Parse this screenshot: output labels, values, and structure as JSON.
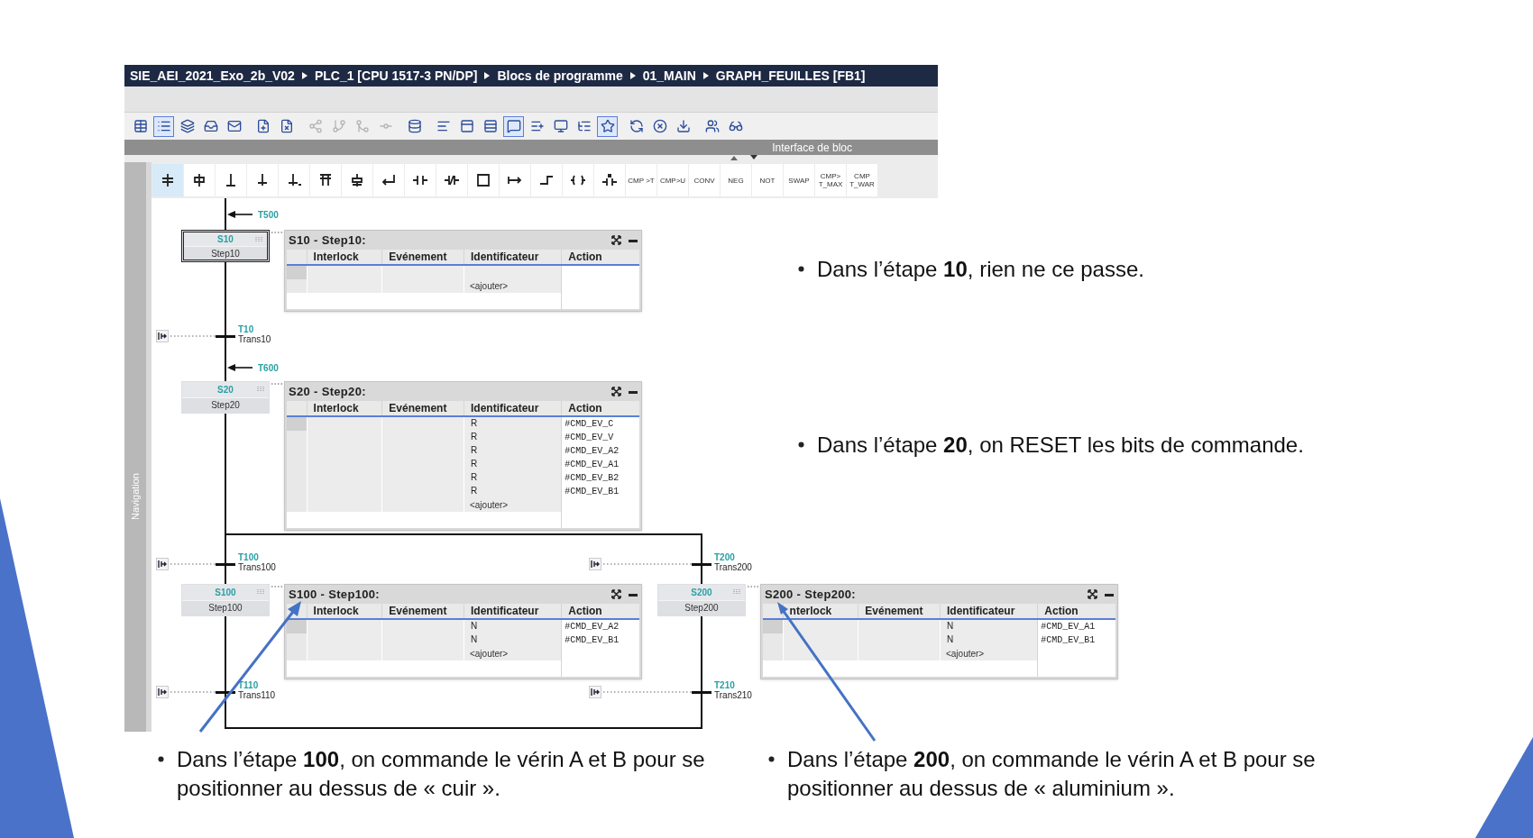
{
  "breadcrumb": [
    "SIE_AEI_2021_Exo_2b_V02",
    "PLC_1 [CPU 1517-3 PN/DP]",
    "Blocs de programme",
    "01_MAIN",
    "GRAPH_FEUILLES [FB1]"
  ],
  "toolbar": [
    {
      "selected": false,
      "disabled": false
    },
    {
      "selected": true,
      "disabled": false
    },
    {
      "selected": false,
      "disabled": false
    },
    {
      "selected": false,
      "disabled": false
    },
    {
      "selected": false,
      "disabled": false
    },
    {
      "selected": false,
      "disabled": false
    },
    {
      "selected": false,
      "disabled": false
    },
    {
      "selected": false,
      "disabled": true
    },
    {
      "selected": false,
      "disabled": true
    },
    {
      "selected": false,
      "disabled": true
    },
    {
      "selected": false,
      "disabled": true
    },
    {
      "selected": false,
      "disabled": false
    },
    {
      "selected": false,
      "disabled": false
    },
    {
      "selected": false,
      "disabled": false
    },
    {
      "selected": false,
      "disabled": false
    },
    {
      "selected": true,
      "disabled": false
    },
    {
      "selected": false,
      "disabled": false
    },
    {
      "selected": false,
      "disabled": false
    },
    {
      "selected": false,
      "disabled": false
    },
    {
      "selected": true,
      "disabled": false
    },
    {
      "selected": false,
      "disabled": false
    },
    {
      "selected": false,
      "disabled": false
    },
    {
      "selected": false,
      "disabled": false
    },
    {
      "selected": false,
      "disabled": false
    },
    {
      "selected": false,
      "disabled": false
    }
  ],
  "interface_label": "Interface de bloc",
  "palette": [
    {
      "kind": "icon",
      "selected": true
    },
    {
      "kind": "icon",
      "selected": false
    },
    {
      "kind": "icon",
      "selected": false
    },
    {
      "kind": "icon",
      "selected": false
    },
    {
      "kind": "icon",
      "selected": false
    },
    {
      "kind": "icon",
      "selected": false
    },
    {
      "kind": "icon",
      "selected": false
    },
    {
      "kind": "icon",
      "selected": false
    },
    {
      "kind": "icon",
      "selected": false
    },
    {
      "kind": "icon",
      "selected": false
    },
    {
      "kind": "icon",
      "selected": false
    },
    {
      "kind": "icon",
      "selected": false
    },
    {
      "kind": "icon",
      "selected": false
    },
    {
      "kind": "icon",
      "selected": false
    },
    {
      "kind": "icon",
      "selected": false
    },
    {
      "kind": "text",
      "selected": false,
      "lines": [
        "CMP >T"
      ]
    },
    {
      "kind": "text",
      "selected": false,
      "lines": [
        "CMP>U"
      ]
    },
    {
      "kind": "text",
      "selected": false,
      "lines": [
        "CONV"
      ]
    },
    {
      "kind": "text",
      "selected": false,
      "lines": [
        "NEG"
      ]
    },
    {
      "kind": "text",
      "selected": false,
      "lines": [
        "NOT"
      ]
    },
    {
      "kind": "text",
      "selected": false,
      "lines": [
        "SWAP"
      ]
    },
    {
      "kind": "text",
      "selected": false,
      "lines": [
        "CMP>",
        "T_MAX"
      ]
    },
    {
      "kind": "text",
      "selected": false,
      "lines": [
        "CMP",
        "T_WAR"
      ]
    }
  ],
  "navigation_label": "Navigation",
  "graph": {
    "jumps": [
      {
        "label": "T500"
      },
      {
        "label": "T600"
      }
    ],
    "steps": [
      {
        "number": "S10",
        "name": "Step10",
        "selected": true,
        "table": {
          "title": "S10 - Step10:",
          "columns": [
            "Interlock",
            "Evénement",
            "Identificateur",
            "Action"
          ],
          "add_label": "<ajouter>"
        }
      },
      {
        "number": "S20",
        "name": "Step20",
        "selected": false,
        "table": {
          "title": "S20 - Step20:",
          "columns": [
            "Interlock",
            "Evénement",
            "Identificateur",
            "Action"
          ],
          "rows": [
            {
              "identifier": "R",
              "action": "#CMD_EV_C"
            },
            {
              "identifier": "R",
              "action": "#CMD_EV_V"
            },
            {
              "identifier": "R",
              "action": "#CMD_EV_A2"
            },
            {
              "identifier": "R",
              "action": "#CMD_EV_A1"
            },
            {
              "identifier": "R",
              "action": "#CMD_EV_B2"
            },
            {
              "identifier": "R",
              "action": "#CMD_EV_B1"
            }
          ],
          "add_label": "<ajouter>"
        }
      },
      {
        "number": "S100",
        "name": "Step100",
        "selected": false,
        "table": {
          "title": "S100 - Step100:",
          "columns": [
            "Interlock",
            "Evénement",
            "Identificateur",
            "Action"
          ],
          "rows": [
            {
              "identifier": "N",
              "action": "#CMD_EV_A2"
            },
            {
              "identifier": "N",
              "action": "#CMD_EV_B1"
            }
          ],
          "add_label": "<ajouter>"
        }
      },
      {
        "number": "S200",
        "name": "Step200",
        "selected": false,
        "table": {
          "title": "S200 - Step200:",
          "columns": [
            "nterlock",
            "Evénement",
            "Identificateur",
            "Action"
          ],
          "rows": [
            {
              "identifier": "N",
              "action": "#CMD_EV_A1"
            },
            {
              "identifier": "N",
              "action": "#CMD_EV_B1"
            }
          ],
          "add_label": "<ajouter>"
        }
      }
    ],
    "transitions": [
      {
        "number": "T10",
        "name": "Trans10"
      },
      {
        "number": "T100",
        "name": "Trans100"
      },
      {
        "number": "T110",
        "name": "Trans110"
      },
      {
        "number": "T200",
        "name": "Trans200"
      },
      {
        "number": "T210",
        "name": "Trans210"
      }
    ]
  },
  "notes": [
    "Dans l’étape **10**, rien ne ce passe.",
    "Dans l’étape **20**, on RESET les bits de commande.",
    "Dans l’étape **100**, on commande le vérin A et B pour se positionner au dessus de « cuir ».",
    "Dans l’étape **200**, on commande le vérin A et B pour se positionner au dessus de « aluminium »."
  ]
}
